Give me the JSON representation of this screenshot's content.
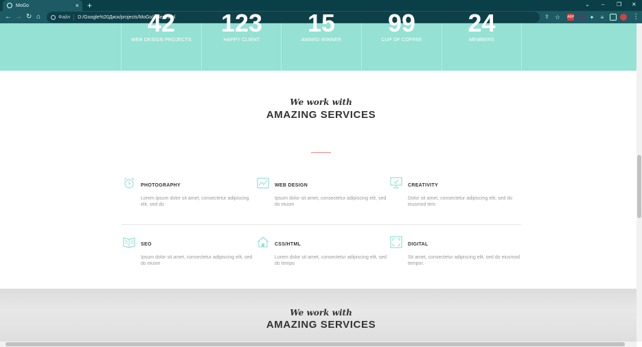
{
  "browser": {
    "tab_title": "MoGo",
    "close_glyph": "×",
    "new_tab_glyph": "+",
    "address_label": "Файл",
    "url": "D:/Google%20Диск/projects/MoGo/index.html",
    "ext_abp": "ABP"
  },
  "stats": [
    {
      "value": "42",
      "label": "WEB DESIGN PROJECTS"
    },
    {
      "value": "123",
      "label": "HAPPY CLIENT"
    },
    {
      "value": "15",
      "label": "AWARD WINNER"
    },
    {
      "value": "99",
      "label": "CUP OF COFFEE"
    },
    {
      "value": "24",
      "label": "MEMBERS"
    }
  ],
  "services": {
    "script_title": "We work with",
    "title": "AMAZING SERVICES",
    "items": [
      {
        "icon": "alarm-clock-icon",
        "name": "PHOTOGRAPHY",
        "desc": "Lorem ipsum dolor sit amet, consectetur adipiscing elit, sed do"
      },
      {
        "icon": "chart-icon",
        "name": "WEB DESIGN",
        "desc": "Ipsum dolor sit amet, consectetur adipiscing elit, sed do eiusm"
      },
      {
        "icon": "monitor-icon",
        "name": "CREATIVITY",
        "desc": "Dolor sit amet, consectetur adipiscing elit, sed do eiusmod tem"
      },
      {
        "icon": "book-icon",
        "name": "SEO",
        "desc": "Ipsum dolor sit amet, consectetur adipiscing elit, sed do eiusm"
      },
      {
        "icon": "house-icon",
        "name": "CSS/HTML",
        "desc": "Lorem dolor sit amet, consectetur adipiscing elit, sed do tempo"
      },
      {
        "icon": "frame-icon",
        "name": "DIGITAL",
        "desc": "Sit amet, consectetur adipiscing elit, sed do eiusmod tempor."
      }
    ]
  },
  "next_section": {
    "script_title": "We work with",
    "title": "AMAZING SERVICES"
  },
  "colors": {
    "accent": "#95e1d3",
    "red_line": "#f38181",
    "chrome": "#1d5a64"
  }
}
